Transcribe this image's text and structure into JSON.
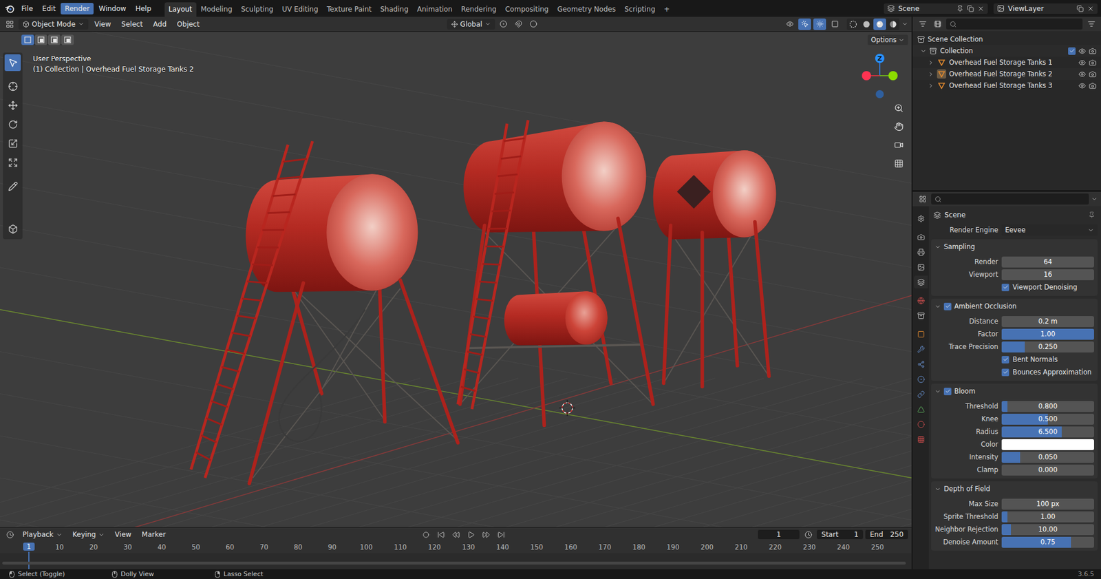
{
  "topbar": {
    "menus": [
      {
        "label": "File",
        "selected": false
      },
      {
        "label": "Edit",
        "selected": false
      },
      {
        "label": "Render",
        "selected": true
      },
      {
        "label": "Window",
        "selected": false
      },
      {
        "label": "Help",
        "selected": false
      }
    ],
    "workspaces": [
      {
        "label": "Layout",
        "selected": true
      },
      {
        "label": "Modeling",
        "selected": false
      },
      {
        "label": "Sculpting",
        "selected": false
      },
      {
        "label": "UV Editing",
        "selected": false
      },
      {
        "label": "Texture Paint",
        "selected": false
      },
      {
        "label": "Shading",
        "selected": false
      },
      {
        "label": "Animation",
        "selected": false
      },
      {
        "label": "Rendering",
        "selected": false
      },
      {
        "label": "Compositing",
        "selected": false
      },
      {
        "label": "Geometry Nodes",
        "selected": false
      },
      {
        "label": "Scripting",
        "selected": false
      }
    ],
    "add_workspace": "+",
    "scene": "Scene",
    "view_layer": "ViewLayer"
  },
  "viewport_header": {
    "menus": [
      {
        "label": "Object Mode",
        "dropdown": true
      },
      {
        "label": "View",
        "dropdown": false
      },
      {
        "label": "Select",
        "dropdown": false
      },
      {
        "label": "Add",
        "dropdown": false
      },
      {
        "label": "Object",
        "dropdown": false
      }
    ],
    "orientation": "Global",
    "shading": [
      {
        "kind": "wireframe",
        "selected": false
      },
      {
        "kind": "solid",
        "selected": false
      },
      {
        "kind": "material",
        "selected": true
      },
      {
        "kind": "rendered",
        "selected": false
      }
    ]
  },
  "tool_settings": {
    "select_modes": [
      {
        "selected": true
      },
      {
        "selected": false
      },
      {
        "selected": false
      },
      {
        "selected": false
      }
    ],
    "options": "Options"
  },
  "viewport": {
    "view_name": "User Perspective",
    "context": "(1) Collection | Overhead Fuel Storage Tanks 2",
    "gizmo_axis": "Z",
    "tools": [
      {
        "kind": "select",
        "selected": true
      },
      {
        "kind": "cursor",
        "selected": false
      },
      {
        "kind": "move",
        "selected": false
      },
      {
        "kind": "rotate",
        "selected": false
      },
      {
        "kind": "scale",
        "selected": false
      },
      {
        "kind": "transform",
        "selected": false
      },
      {
        "kind": "annotate",
        "selected": false
      },
      {
        "kind": "measure",
        "selected": false
      },
      {
        "kind": "add-cube",
        "selected": false
      }
    ]
  },
  "outliner": {
    "root": "Scene Collection",
    "collection": {
      "label": "Collection",
      "expanded": true,
      "checked": true,
      "visible": true
    },
    "items": [
      {
        "label": "Overhead Fuel Storage Tanks 1",
        "selected": false,
        "visible": true
      },
      {
        "label": "Overhead Fuel Storage Tanks 2",
        "selected": true,
        "visible": true
      },
      {
        "label": "Overhead Fuel Storage Tanks 3",
        "selected": false,
        "visible": true
      }
    ]
  },
  "properties": {
    "tabs": [
      {
        "kind": "tool",
        "selected": false
      },
      {
        "kind": "render",
        "selected": false
      },
      {
        "kind": "output",
        "selected": false
      },
      {
        "kind": "view-layer",
        "selected": false
      },
      {
        "kind": "scene",
        "selected": true
      },
      {
        "kind": "world",
        "selected": false
      },
      {
        "kind": "collection",
        "selected": false
      },
      {
        "kind": "object",
        "selected": false
      },
      {
        "kind": "modifiers",
        "selected": false
      },
      {
        "kind": "particles",
        "selected": false
      },
      {
        "kind": "physics",
        "selected": false
      },
      {
        "kind": "constraints",
        "selected": false
      },
      {
        "kind": "data",
        "selected": false
      },
      {
        "kind": "material",
        "selected": false
      },
      {
        "kind": "texture",
        "selected": false
      }
    ],
    "context": "Scene",
    "render_engine_label": "Render Engine",
    "render_engine": "Eevee",
    "panels": [
      {
        "title": "Sampling",
        "toggle": false,
        "enabled": true,
        "expanded": true,
        "rows": [
          {
            "kind": "number",
            "label": "Render",
            "value": "64"
          },
          {
            "kind": "number",
            "label": "Viewport",
            "value": "16"
          },
          {
            "kind": "checkbox",
            "label": "Viewport Denoising",
            "checked": true
          }
        ]
      },
      {
        "title": "Ambient Occlusion",
        "toggle": true,
        "enabled": true,
        "expanded": true,
        "rows": [
          {
            "kind": "number",
            "label": "Distance",
            "value": "0.2 m"
          },
          {
            "kind": "slider",
            "label": "Factor",
            "value": "1.00",
            "level": 1
          },
          {
            "kind": "slider",
            "label": "Trace Precision",
            "value": "0.250",
            "level": 0.25
          },
          {
            "kind": "checkbox",
            "label": "Bent Normals",
            "checked": true
          },
          {
            "kind": "checkbox",
            "label": "Bounces Approximation",
            "checked": true
          }
        ]
      },
      {
        "title": "Bloom",
        "toggle": true,
        "enabled": true,
        "expanded": true,
        "rows": [
          {
            "kind": "slider",
            "label": "Threshold",
            "value": "0.800",
            "level": 0.06
          },
          {
            "kind": "slider",
            "label": "Knee",
            "value": "0.500",
            "level": 0.5
          },
          {
            "kind": "slider",
            "label": "Radius",
            "value": "6.500",
            "level": 0.65
          },
          {
            "kind": "color",
            "label": "Color",
            "swatch": "#ffffff"
          },
          {
            "kind": "slider",
            "label": "Intensity",
            "value": "0.050",
            "level": 0.2
          },
          {
            "kind": "slider",
            "label": "Clamp",
            "value": "0.000",
            "level": 0
          }
        ]
      },
      {
        "title": "Depth of Field",
        "toggle": false,
        "enabled": true,
        "expanded": true,
        "rows": [
          {
            "kind": "number",
            "label": "Max Size",
            "value": "100 px"
          },
          {
            "kind": "slider",
            "label": "Sprite Threshold",
            "value": "1.00",
            "level": 0.06
          },
          {
            "kind": "slider",
            "label": "Neighbor Rejection",
            "value": "10.00",
            "level": 0.1
          },
          {
            "kind": "slider",
            "label": "Denoise Amount",
            "value": "0.75",
            "level": 0.75
          }
        ]
      }
    ]
  },
  "timeline": {
    "menus": [
      {
        "label": "Playback",
        "dropdown": true
      },
      {
        "label": "Keying",
        "dropdown": true
      },
      {
        "label": "View",
        "dropdown": false
      },
      {
        "label": "Marker",
        "dropdown": false
      }
    ],
    "frame": "1",
    "start_label": "Start",
    "start": "1",
    "end_label": "End",
    "end": "250",
    "current": "1",
    "ticks": [
      "10",
      "20",
      "30",
      "40",
      "50",
      "60",
      "70",
      "80",
      "90",
      "100",
      "110",
      "120",
      "130",
      "140",
      "150",
      "160",
      "170",
      "180",
      "190",
      "200",
      "210",
      "220",
      "230",
      "240",
      "250"
    ]
  },
  "status_bar": {
    "items": [
      {
        "label": "Select (Toggle)"
      },
      {
        "label": "Dolly View"
      },
      {
        "label": "Lasso Select"
      }
    ],
    "version": "3.6.5"
  }
}
